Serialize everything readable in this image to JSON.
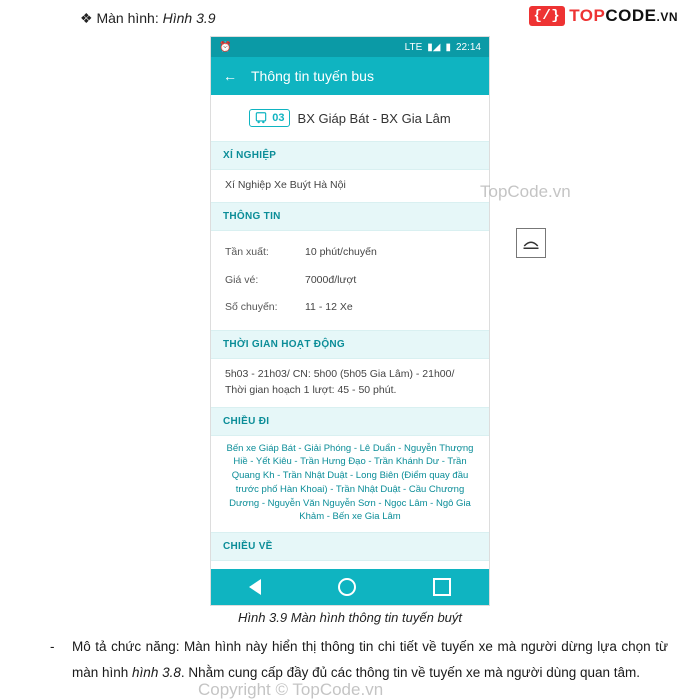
{
  "doc": {
    "bullet_label": "Màn hình:",
    "bullet_ref": "Hình 3.9",
    "caption": "Hình 3.9 Màn hình thông tin tuyến buýt",
    "desc_prefix": "Mô tả chức năng: Màn hình này hiển thị thông tin chi tiết về tuyến xe mà người dừng lựa chọn từ màn hình ",
    "desc_ref": "hình 3.8",
    "desc_suffix": ". Nhằm cung cấp đầy đủ các thông tin về tuyến xe mà người dùng quan tâm."
  },
  "logo": {
    "mark": "{/}",
    "top": "TOP",
    "code": "CODE",
    "vn": ".VN"
  },
  "watermarks": {
    "w1": "TopCode.vn",
    "w2": "Copyright © TopCode.vn"
  },
  "phone": {
    "status_time": "22:14",
    "status_lte": "LTE",
    "appbar_title": "Thông tin tuyến bus",
    "route_number": "03",
    "route_name": "BX Giáp Bát - BX Gia Lâm",
    "sections": {
      "xinghiep": {
        "head": "XÍ NGHIỆP",
        "value": "Xí Nghiệp Xe Buýt Hà Nội"
      },
      "thongtin": {
        "head": "THÔNG TIN",
        "rows": [
          {
            "k": "Tần xuất:",
            "v": "10 phút/chuyến"
          },
          {
            "k": "Giá vé:",
            "v": "7000đ/lượt"
          },
          {
            "k": "Số chuyến:",
            "v": "11 - 12 Xe"
          }
        ]
      },
      "thoigian": {
        "head": "THỜI GIAN HOẠT ĐỘNG",
        "value": "5h03 - 21h03/ CN: 5h00 (5h05 Gia Lâm) - 21h00/ Thời gian hoạch 1 lượt: 45 - 50 phút."
      },
      "chieudi": {
        "head": "CHIỀU ĐI",
        "value": "Bến xe Giáp Bát - Giải Phóng - Lê Duẩn - Nguyễn Thượng Hiề - Yết Kiêu - Trần Hưng Đạo - Trần Khánh Dư - Trần Quang Kh - Trần Nhật Duật - Long Biên (Điểm quay đầu trước phố Hàn Khoai) - Trần Nhật Duật - Cầu Chương Dương - Nguyễn Văn Nguyễn Sơn - Ngọc Lâm - Ngô Gia Khảm - Bến xe Gia Lâm"
      },
      "chieuve": {
        "head": "CHIỀU VỀ"
      }
    }
  }
}
